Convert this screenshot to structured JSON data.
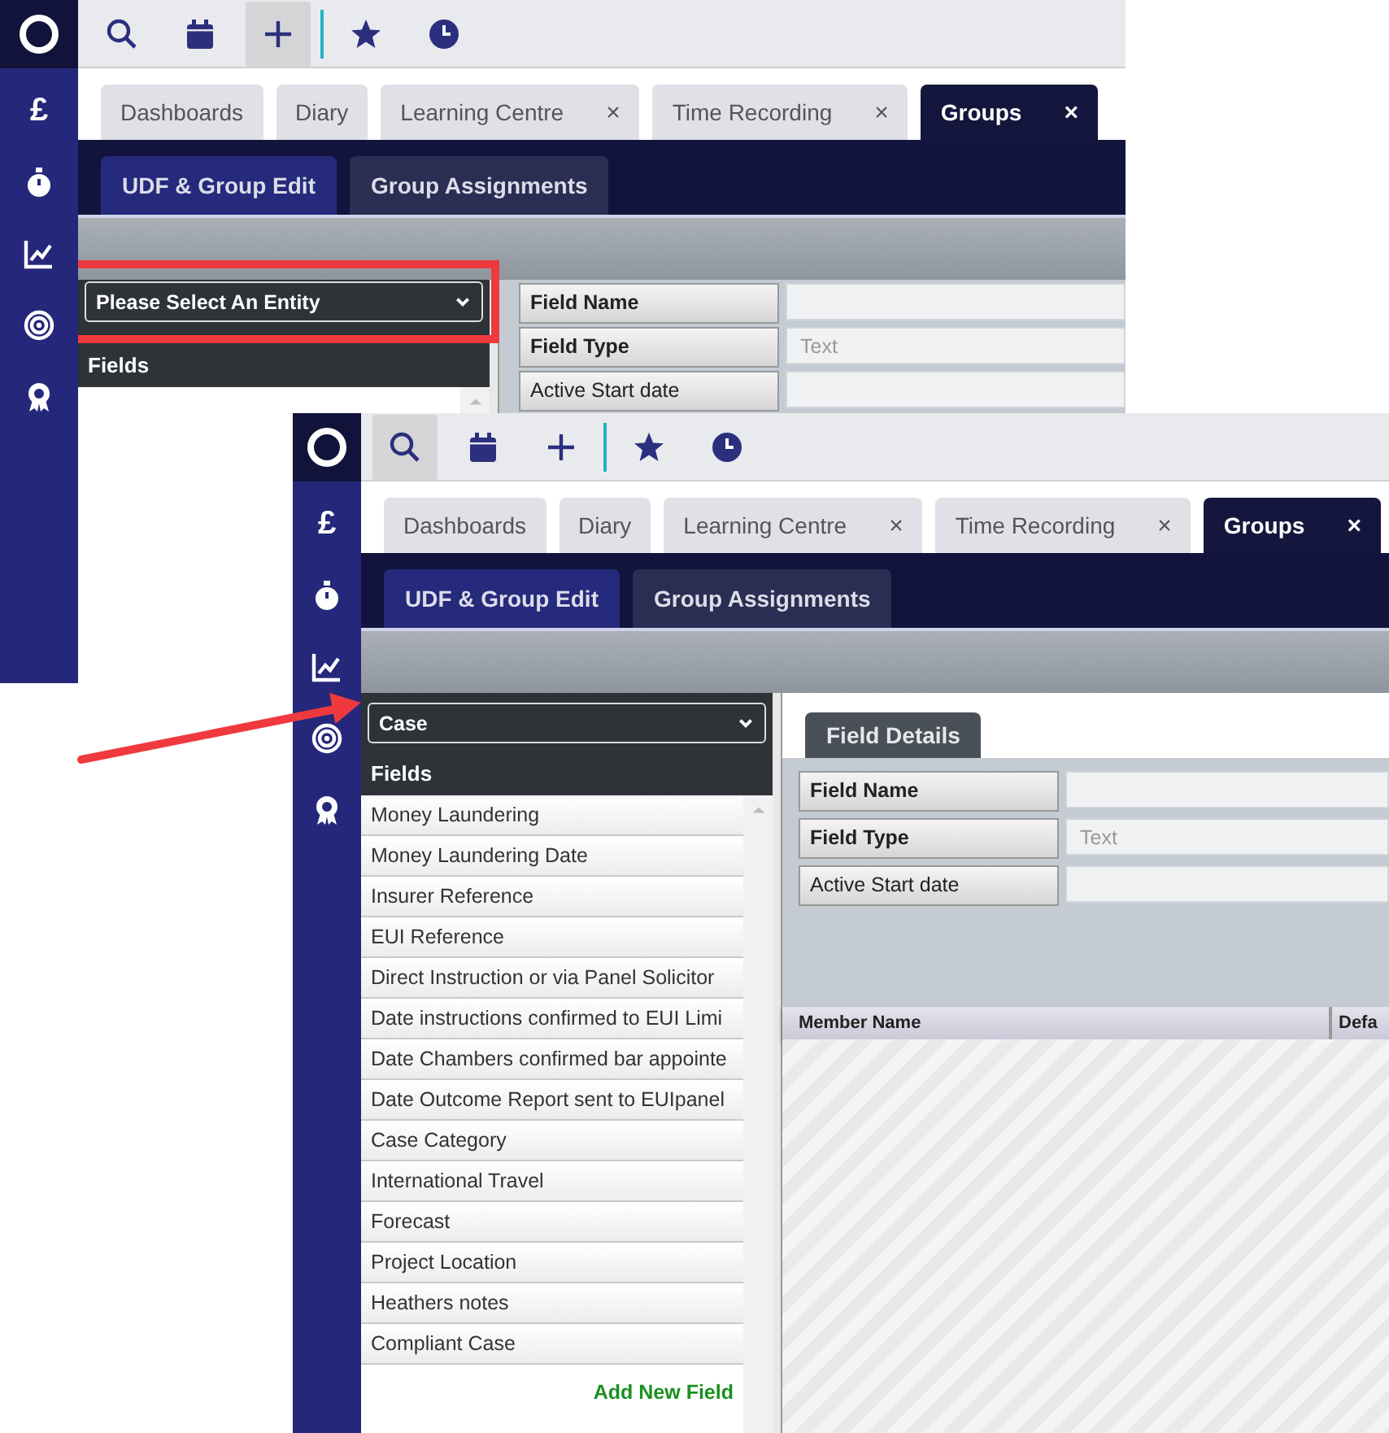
{
  "screens": [
    {
      "sidebar": [
        {
          "kind": "glyph",
          "glyph": "£"
        },
        {
          "kind": "stopwatch"
        },
        {
          "kind": "chart"
        },
        {
          "kind": "target"
        },
        {
          "kind": "award"
        }
      ],
      "toolbar": [
        {
          "kind": "search",
          "selected": false
        },
        {
          "kind": "calendar",
          "selected": false
        },
        {
          "kind": "plus",
          "selected": true
        },
        {
          "kind": "star",
          "selected": false
        },
        {
          "kind": "clock",
          "selected": false
        }
      ],
      "tabs": [
        {
          "label": "Dashboards",
          "selected": false
        },
        {
          "label": "Diary",
          "selected": false
        },
        {
          "label": "Learning Centre",
          "close": "×",
          "selected": false
        },
        {
          "label": "Time Recording",
          "close": "×",
          "selected": false
        },
        {
          "label": "Groups",
          "close": "×",
          "selected": true
        }
      ],
      "subtabs": [
        {
          "label": "UDF & Group Edit",
          "selected": true
        },
        {
          "label": "Group Assignments",
          "selected": false
        }
      ],
      "entity_select": {
        "value": "Please Select An Entity",
        "highlighted": true
      },
      "fields_heading": "Fields",
      "detail_rows": [
        {
          "label": "Field Name",
          "required": true
        },
        {
          "label": "Field Type",
          "required": true,
          "placeholder": "Text"
        },
        {
          "label": "Active Start date",
          "required": false
        }
      ]
    },
    {
      "sidebar": [
        {
          "kind": "glyph",
          "glyph": "£"
        },
        {
          "kind": "stopwatch"
        },
        {
          "kind": "chart"
        },
        {
          "kind": "target"
        },
        {
          "kind": "award"
        }
      ],
      "toolbar": [
        {
          "kind": "search",
          "selected": true
        },
        {
          "kind": "calendar",
          "selected": false
        },
        {
          "kind": "plus",
          "selected": false
        },
        {
          "kind": "star",
          "selected": false
        },
        {
          "kind": "clock",
          "selected": false
        }
      ],
      "tabs": [
        {
          "label": "Dashboards",
          "selected": false
        },
        {
          "label": "Diary",
          "selected": false
        },
        {
          "label": "Learning Centre",
          "close": "×",
          "selected": false
        },
        {
          "label": "Time Recording",
          "close": "×",
          "selected": false
        },
        {
          "label": "Groups",
          "close": "×",
          "selected": true
        }
      ],
      "subtabs": [
        {
          "label": "UDF & Group Edit",
          "selected": true
        },
        {
          "label": "Group Assignments",
          "selected": false
        }
      ],
      "entity_select": {
        "value": "Case"
      },
      "fields_heading": "Fields",
      "fields": [
        "Money Laundering",
        "Money Laundering Date",
        "Insurer Reference",
        "EUI Reference",
        "Direct Instruction or via Panel Solicitor",
        "Date instructions confirmed to EUI Limi",
        "Date Chambers confirmed bar appointe",
        "Date Outcome Report sent to EUIpanel",
        "Case Category",
        "International Travel",
        "Forecast",
        "Project Location",
        "Heathers notes",
        "Compliant Case"
      ],
      "add_field_link": "Add New Field",
      "details_tab": "Field Details",
      "detail_rows": [
        {
          "label": "Field Name",
          "required": true
        },
        {
          "label": "Field Type",
          "required": true,
          "placeholder": "Text"
        },
        {
          "label": "Active Start date",
          "required": false
        }
      ],
      "member_columns": [
        "Member Name",
        "Defa"
      ]
    }
  ]
}
